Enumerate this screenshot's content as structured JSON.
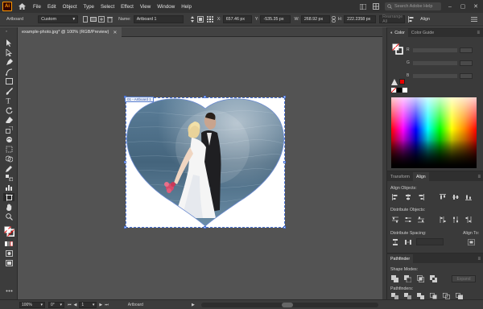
{
  "app": {
    "logo": "Ai"
  },
  "menu": {
    "items": [
      "File",
      "Edit",
      "Object",
      "Type",
      "Select",
      "Effect",
      "View",
      "Window",
      "Help"
    ],
    "search_placeholder": "Search Adobe Help"
  },
  "controlbar": {
    "selection_label": "Artboard",
    "preset": "Custom",
    "name_label": "Name:",
    "name_value": "Artboard 1",
    "x_label": "X:",
    "x_value": "657.46 px",
    "y_label": "Y:",
    "y_value": "-535.35 px",
    "w_label": "W:",
    "w_value": "268.92 px",
    "h_label": "H:",
    "h_value": "222.2358 px",
    "rearrange_label": "Rearrange All",
    "align_label": "Align"
  },
  "document": {
    "tab_title": "example-photo.jpg* @ 100% (RGB/Preview)",
    "artboard_label": "01 - Artboard 1"
  },
  "statusbar": {
    "zoom": "100%",
    "rotation": "0°",
    "artboard_number": "1",
    "mode": "Artboard"
  },
  "panels": {
    "color_tabs": [
      "Color",
      "Color Guide"
    ],
    "color_rows": [
      "R",
      "G",
      "B"
    ],
    "lower_tabs": [
      "Transform",
      "Align"
    ],
    "align_objects": "Align Objects:",
    "distribute_objects": "Distribute Objects:",
    "distribute_spacing": "Distribute Spacing:",
    "align_to": "Align To:",
    "pathfinder_tab": "Pathfinder",
    "shape_modes": "Shape Modes:",
    "expand": "Expand",
    "pathfinders": "Pathfinders:"
  },
  "colors": {
    "menubar_bg": "#323232",
    "panel_bg": "#3c3c3c",
    "canvas_bg": "#535353",
    "accent": "#ff9a00",
    "selection": "#4a74d8"
  }
}
